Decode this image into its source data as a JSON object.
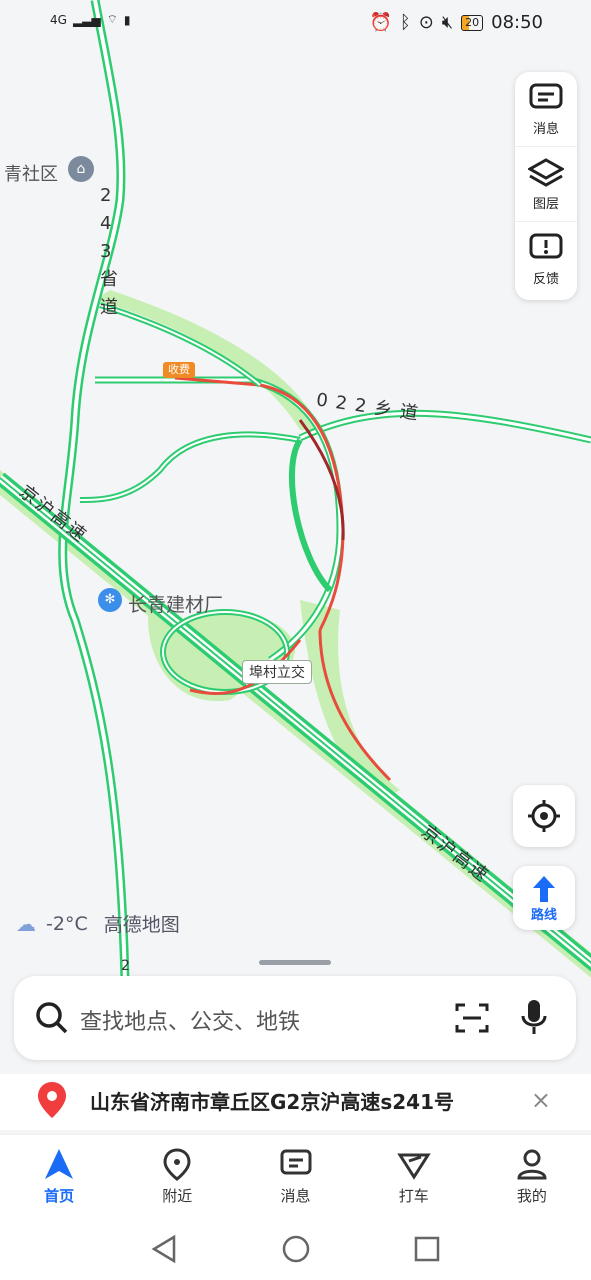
{
  "status_bar": {
    "network": "4G",
    "battery": "20",
    "time": "08:50"
  },
  "map": {
    "labels": {
      "community": "青社区",
      "provincial_road": "243省道",
      "township_road": "022乡道",
      "expressway_a": "京沪高速",
      "expressway_b": "京沪高速",
      "factory": "长青建材厂",
      "interchange": "埠村立交",
      "toll": "收费",
      "bottom_road_num": "2"
    },
    "colors": {
      "road_green": "#2ecc71",
      "road_red": "#e74c3c",
      "road_darkred": "#a0282a",
      "greenspace": "#c7efb3",
      "accent": "#1a6cf6"
    }
  },
  "right_panel": {
    "messages_label": "消息",
    "layers_label": "图层",
    "feedback_label": "反馈"
  },
  "route_button": {
    "label": "路线"
  },
  "weather": {
    "temp": "-2°C",
    "brand": "高德地图"
  },
  "search": {
    "placeholder": "查找地点、公交、地铁"
  },
  "location_card": {
    "address": "山东省济南市章丘区G2京沪高速s241号",
    "close": "×"
  },
  "tabs": [
    {
      "label": "首页",
      "icon": "navigate-arrow-icon",
      "active": true
    },
    {
      "label": "附近",
      "icon": "nearby-pin-icon"
    },
    {
      "label": "消息",
      "icon": "message-icon"
    },
    {
      "label": "打车",
      "icon": "taxi-icon"
    },
    {
      "label": "我的",
      "icon": "profile-icon"
    }
  ]
}
